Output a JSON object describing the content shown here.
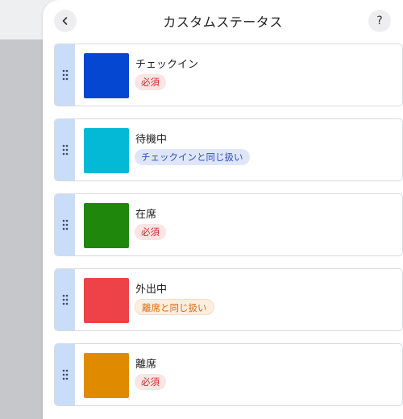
{
  "header": {
    "title": "カスタムステータス",
    "help_label": "?"
  },
  "statuses": [
    {
      "name": "チェックイン",
      "badge": "必須",
      "badge_type": "required",
      "color": "#0547d1"
    },
    {
      "name": "待機中",
      "badge": "チェックインと同じ扱い",
      "badge_type": "same-checkin",
      "color": "#03b9d6"
    },
    {
      "name": "在席",
      "badge": "必須",
      "badge_type": "required",
      "color": "#1f870b"
    },
    {
      "name": "外出中",
      "badge": "離席と同じ扱い",
      "badge_type": "same-away",
      "color": "#ed4348"
    },
    {
      "name": "離席",
      "badge": "必須",
      "badge_type": "required",
      "color": "#e08a00"
    }
  ]
}
